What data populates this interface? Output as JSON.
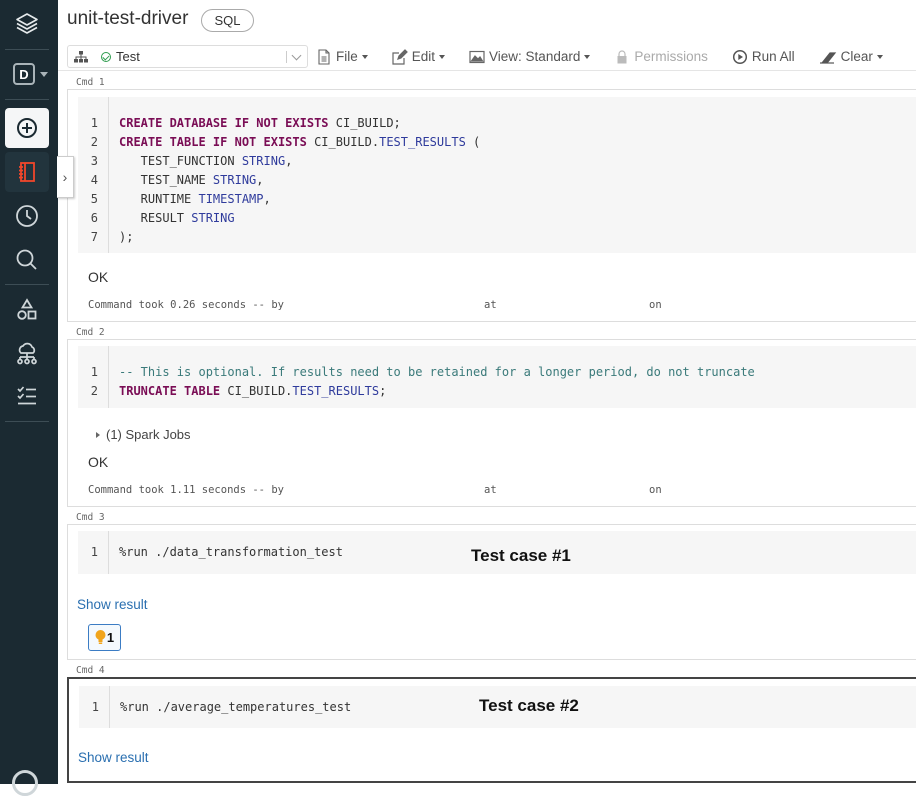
{
  "notebook": {
    "title": "unit-test-driver",
    "language": "SQL"
  },
  "cluster": {
    "name": "Test",
    "status": "running",
    "status_color": "#2e9c4e"
  },
  "toolbar": {
    "file": "File",
    "edit": "Edit",
    "view": "View: Standard",
    "permissions": "Permissions",
    "run_all": "Run All",
    "clear": "Clear"
  },
  "sidebar": {
    "workspace_initial": "D",
    "items": [
      {
        "icon": "layers-icon",
        "label": "Home"
      },
      {
        "icon": "workspace-icon",
        "label": "Workspace"
      },
      {
        "icon": "plus-circle-icon",
        "label": "Create"
      },
      {
        "icon": "notebook-icon",
        "label": "Notebook"
      },
      {
        "icon": "clock-icon",
        "label": "Recents"
      },
      {
        "icon": "search-icon",
        "label": "Search"
      },
      {
        "icon": "shapes-icon",
        "label": "Data"
      },
      {
        "icon": "cloud-network-icon",
        "label": "Compute"
      },
      {
        "icon": "checklist-icon",
        "label": "Jobs"
      },
      {
        "icon": "help-icon",
        "label": "Help"
      }
    ],
    "accent_color": "#f0472b"
  },
  "cells": [
    {
      "label": "Cmd 1",
      "lines": [
        {
          "n": "1",
          "parts": [
            [
              "kw",
              "CREATE DATABASE IF NOT EXISTS"
            ],
            [
              "",
              " CI_BUILD;"
            ]
          ]
        },
        {
          "n": "2",
          "parts": [
            [
              "kw",
              "CREATE TABLE IF NOT EXISTS"
            ],
            [
              "",
              " CI_BUILD."
            ],
            [
              "ty",
              "TEST_RESULTS"
            ],
            [
              "",
              " ("
            ]
          ]
        },
        {
          "n": "3",
          "parts": [
            [
              "",
              "   TEST_FUNCTION "
            ],
            [
              "ty",
              "STRING"
            ],
            [
              "",
              ","
            ]
          ]
        },
        {
          "n": "4",
          "parts": [
            [
              "",
              "   TEST_NAME "
            ],
            [
              "ty",
              "STRING"
            ],
            [
              "",
              ","
            ]
          ]
        },
        {
          "n": "5",
          "parts": [
            [
              "",
              "   RUNTIME "
            ],
            [
              "ty",
              "TIMESTAMP"
            ],
            [
              "",
              ","
            ]
          ]
        },
        {
          "n": "6",
          "parts": [
            [
              "",
              "   RESULT "
            ],
            [
              "ty",
              "STRING"
            ]
          ]
        },
        {
          "n": "7",
          "parts": [
            [
              "",
              ");"
            ]
          ]
        }
      ],
      "output": "OK",
      "took": "Command took 0.26 seconds -- by",
      "at": "at",
      "on": "on"
    },
    {
      "label": "Cmd 2",
      "lines": [
        {
          "n": "1",
          "parts": [
            [
              "cm",
              "-- This is optional. If results need to be retained for a longer period, do not truncate"
            ]
          ]
        },
        {
          "n": "2",
          "parts": [
            [
              "kw",
              "TRUNCATE TABLE"
            ],
            [
              "",
              " CI_BUILD."
            ],
            [
              "ty",
              "TEST_RESULTS"
            ],
            [
              "",
              ";"
            ]
          ]
        }
      ],
      "spark_jobs": "(1) Spark Jobs",
      "output": "OK",
      "took": "Command took 1.11 seconds -- by",
      "at": "at",
      "on": "on"
    },
    {
      "label": "Cmd 3",
      "lines": [
        {
          "n": "1",
          "parts": [
            [
              "",
              "%run ./data_transformation_test"
            ]
          ]
        }
      ],
      "annotation": "Test case #1",
      "show_result": "Show result",
      "hint_count": "1"
    },
    {
      "label": "Cmd 4",
      "lines": [
        {
          "n": "1",
          "parts": [
            [
              "",
              "%run ./average_temperatures_test"
            ]
          ]
        }
      ],
      "annotation": "Test case #2",
      "show_result": "Show result"
    }
  ]
}
